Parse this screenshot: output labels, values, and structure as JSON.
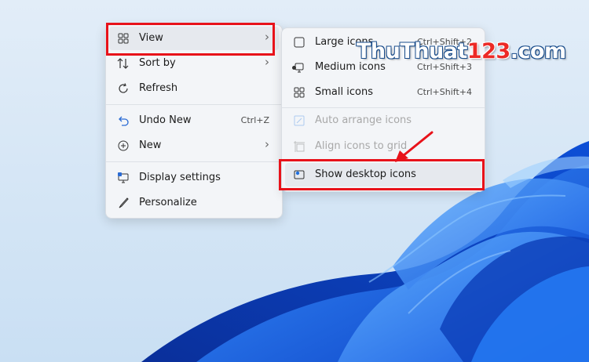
{
  "main_menu": {
    "items": [
      {
        "label": "View",
        "icon": "grid-icon"
      },
      {
        "label": "Sort by",
        "icon": "sort-icon"
      },
      {
        "label": "Refresh",
        "icon": "refresh-icon"
      },
      {
        "label": "Undo New",
        "shortcut": "Ctrl+Z",
        "icon": "undo-icon"
      },
      {
        "label": "New",
        "icon": "plus-circle-icon"
      },
      {
        "label": "Display settings",
        "icon": "monitor-icon"
      },
      {
        "label": "Personalize",
        "icon": "brush-icon"
      }
    ]
  },
  "sub_menu": {
    "items": [
      {
        "label": "Large icons",
        "shortcut": "Ctrl+Shift+2",
        "icon": "large-square-icon"
      },
      {
        "label": "Medium icons",
        "shortcut": "Ctrl+Shift+3",
        "icon": "monitor-small-icon",
        "selected": true
      },
      {
        "label": "Small icons",
        "shortcut": "Ctrl+Shift+4",
        "icon": "grid-icon"
      },
      {
        "label": "Auto arrange icons",
        "icon": "auto-arrange-icon",
        "disabled": true
      },
      {
        "label": "Align icons to grid",
        "icon": "align-grid-icon",
        "disabled": true
      },
      {
        "label": "Show desktop icons",
        "icon": "desktop-icon"
      }
    ]
  },
  "watermark": {
    "text_a": "ThuThuat",
    "text_b": "123",
    "text_c": ".com"
  },
  "colors": {
    "highlight": "#e8121a",
    "wallpaper_blue": "#1e6fe0",
    "background": "#d6e7f6"
  }
}
